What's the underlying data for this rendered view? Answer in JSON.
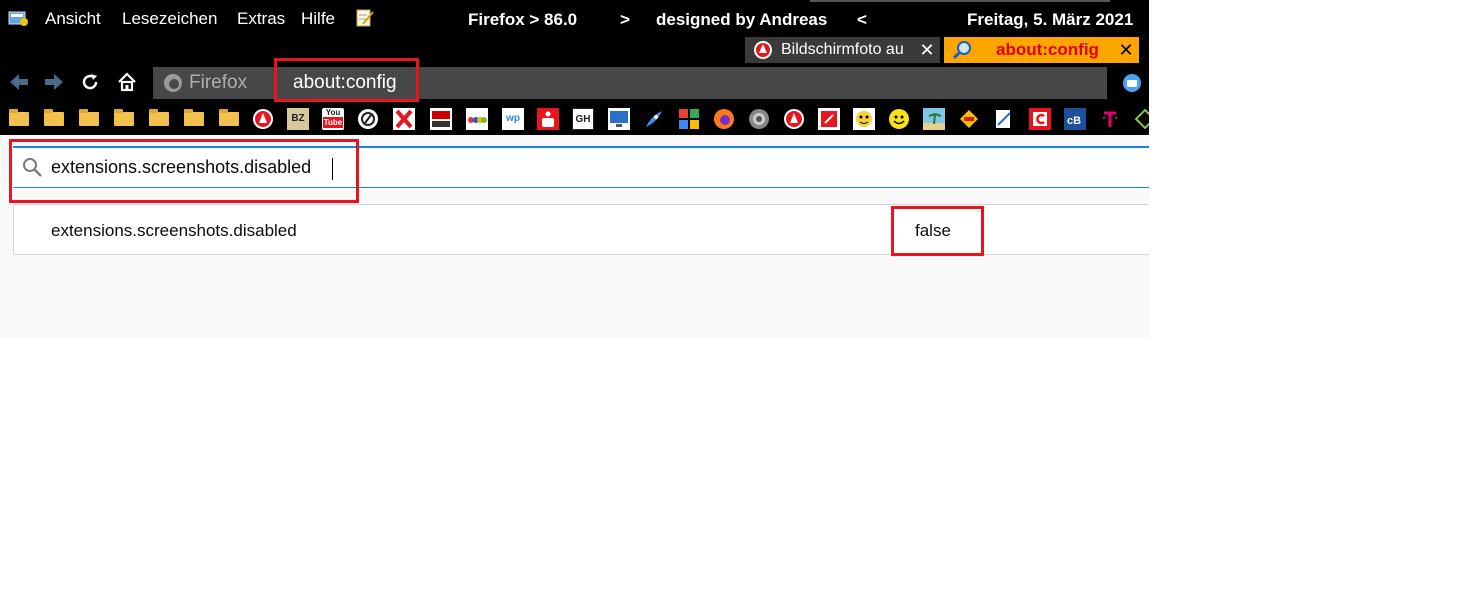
{
  "menubar": {
    "items": [
      "Ansicht",
      "Lesezeichen",
      "Extras",
      "Hilfe"
    ],
    "title_firefox": "Firefox > 86.0",
    "title_arrow": ">",
    "title_designed": "designed by Andreas",
    "title_back": "<",
    "date": "Freitag, 5. März 2021"
  },
  "tabs": [
    {
      "label": "Bildschirmfoto au",
      "close": "✕",
      "active": false
    },
    {
      "label": "about:config",
      "close": "✕",
      "active": true
    }
  ],
  "urlbar": {
    "identity": "Firefox",
    "url": "about:config"
  },
  "bookmarks": {
    "labels": [
      "BZ",
      "You",
      "Tube",
      "GH",
      "wp"
    ]
  },
  "config": {
    "search_value": "extensions.screenshots.disabled",
    "rows": [
      {
        "name": "extensions.screenshots.disabled",
        "value": "false"
      }
    ]
  },
  "colors": {
    "highlight": "#e8141e",
    "active_tab": "#ffa500",
    "accent": "#0a84ff"
  }
}
